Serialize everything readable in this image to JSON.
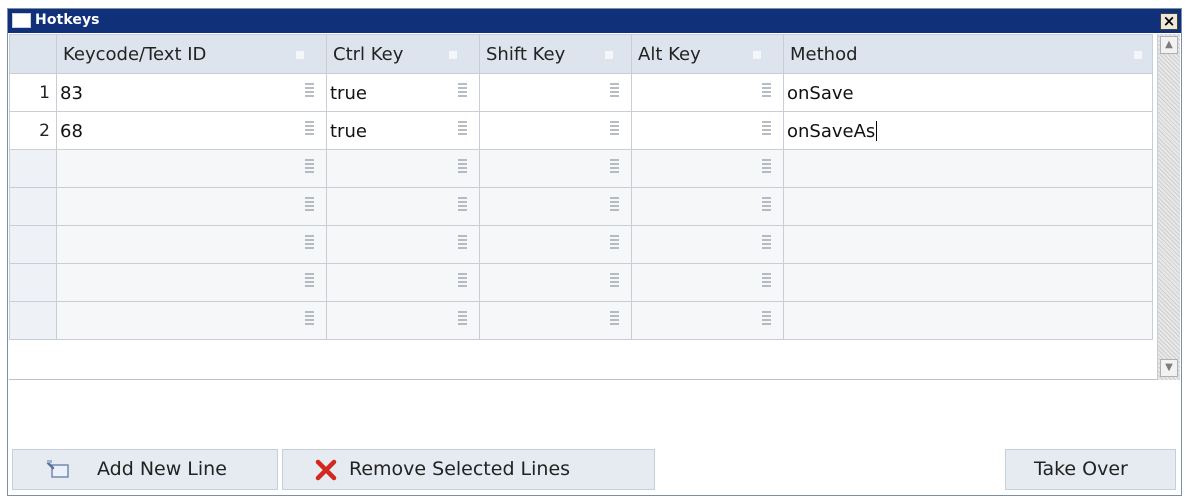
{
  "window": {
    "title": "Hotkeys",
    "icons": {
      "title": "window-icon",
      "close": "close-icon"
    },
    "close_label": "×"
  },
  "grid": {
    "columns": [
      "Keycode/Text ID",
      "Ctrl Key",
      "Shift Key",
      "Alt Key",
      "Method"
    ],
    "rows": [
      {
        "num": "1",
        "keycode": "83",
        "ctrl": "true",
        "shift": "",
        "alt": "",
        "method": "onSave"
      },
      {
        "num": "2",
        "keycode": "68",
        "ctrl": "true",
        "shift": "",
        "alt": "",
        "method": "onSaveAs"
      },
      {
        "num": "",
        "keycode": "",
        "ctrl": "",
        "shift": "",
        "alt": "",
        "method": ""
      },
      {
        "num": "",
        "keycode": "",
        "ctrl": "",
        "shift": "",
        "alt": "",
        "method": ""
      },
      {
        "num": "",
        "keycode": "",
        "ctrl": "",
        "shift": "",
        "alt": "",
        "method": ""
      },
      {
        "num": "",
        "keycode": "",
        "ctrl": "",
        "shift": "",
        "alt": "",
        "method": ""
      },
      {
        "num": "",
        "keycode": "",
        "ctrl": "",
        "shift": "",
        "alt": "",
        "method": ""
      }
    ],
    "scroll": {
      "up_icon": "scroll-up-arrow-icon",
      "down_icon": "scroll-down-arrow-icon",
      "up": "▲",
      "down": "▼"
    }
  },
  "buttons": {
    "add_new_line": {
      "label": "Add New Line",
      "icon": "add-line-icon"
    },
    "remove_selected": {
      "label": "Remove Selected Lines",
      "icon": "remove-x-icon"
    },
    "take_over": {
      "label": "Take Over"
    }
  },
  "colors": {
    "titlebar": "#11307a",
    "header": "#dde4ee",
    "button": "#e6ebf2",
    "remove_icon": "#d2281e"
  }
}
